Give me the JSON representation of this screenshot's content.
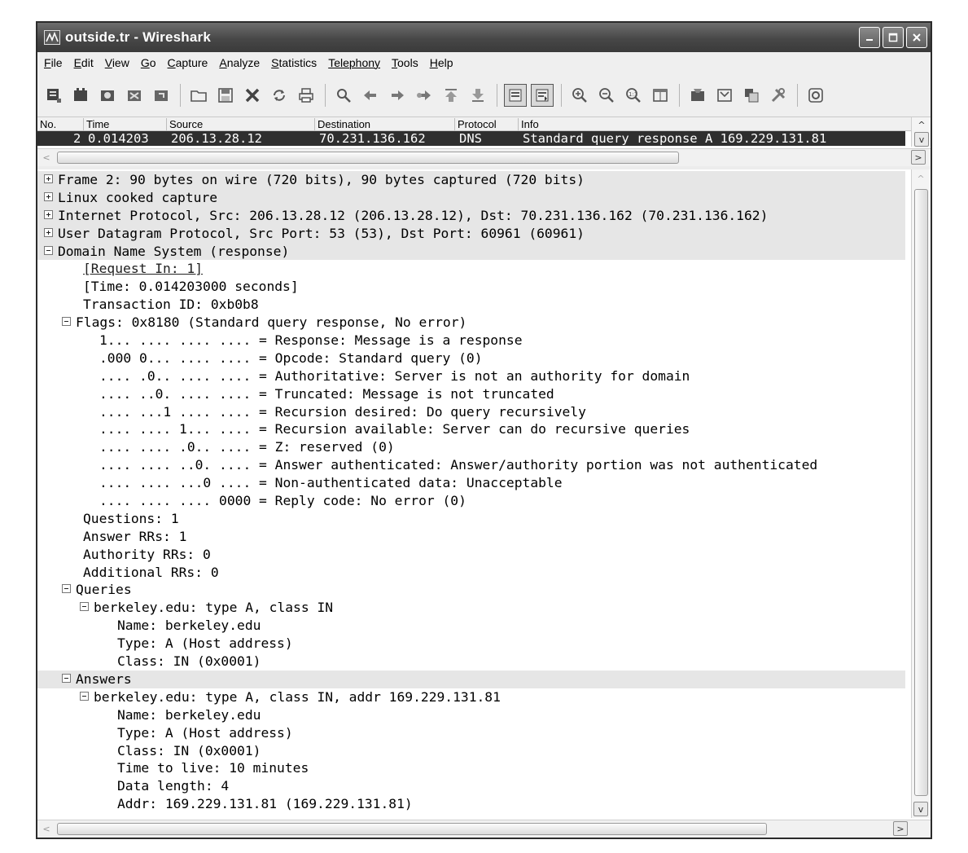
{
  "window": {
    "title": "outside.tr - Wireshark"
  },
  "menu": [
    {
      "acc": "F",
      "rest": "ile"
    },
    {
      "acc": "E",
      "rest": "dit"
    },
    {
      "acc": "V",
      "rest": "iew"
    },
    {
      "acc": "G",
      "rest": "o"
    },
    {
      "acc": "C",
      "rest": "apture"
    },
    {
      "acc": "A",
      "rest": "nalyze"
    },
    {
      "acc": "S",
      "rest": "tatistics"
    },
    {
      "acc": "",
      "rest": "Telephony"
    },
    {
      "acc": "T",
      "rest": "ools"
    },
    {
      "acc": "H",
      "rest": "elp"
    }
  ],
  "packet_list": {
    "columns": [
      "No.",
      "Time",
      "Source",
      "Destination",
      "Protocol",
      "Info"
    ],
    "row": {
      "no": "2",
      "time": "0.014203",
      "source": "206.13.28.12",
      "destination": "70.231.136.162",
      "protocol": "DNS",
      "info": "Standard query response A 169.229.131.81"
    }
  },
  "details": {
    "frame": "Frame 2: 90 bytes on wire (720 bits), 90 bytes captured (720 bits)",
    "linux": "Linux cooked capture",
    "ip": "Internet Protocol, Src: 206.13.28.12 (206.13.28.12), Dst: 70.231.136.162 (70.231.136.162)",
    "udp": "User Datagram Protocol, Src Port: 53 (53), Dst Port: 60961 (60961)",
    "dns": "Domain Name System (response)",
    "request_in": "[Request In: 1]",
    "time": "[Time: 0.014203000 seconds]",
    "txid": "Transaction ID: 0xb0b8",
    "flags": "Flags: 0x8180 (Standard query response, No error)",
    "flag_lines": [
      "1... .... .... .... = Response: Message is a response",
      ".000 0... .... .... = Opcode: Standard query (0)",
      ".... .0.. .... .... = Authoritative: Server is not an authority for domain",
      ".... ..0. .... .... = Truncated: Message is not truncated",
      ".... ...1 .... .... = Recursion desired: Do query recursively",
      ".... .... 1... .... = Recursion available: Server can do recursive queries",
      ".... .... .0.. .... = Z: reserved (0)",
      ".... .... ..0. .... = Answer authenticated: Answer/authority portion was not authenticated",
      ".... .... ...0 .... = Non-authenticated data: Unacceptable",
      ".... .... .... 0000 = Reply code: No error (0)"
    ],
    "questions": "Questions: 1",
    "answer_rrs": "Answer RRs: 1",
    "authority_rrs": "Authority RRs: 0",
    "additional_rrs": "Additional RRs: 0",
    "queries": "Queries",
    "query": "berkeley.edu: type A, class IN",
    "query_fields": [
      "Name: berkeley.edu",
      "Type: A (Host address)",
      "Class: IN (0x0001)"
    ],
    "answers": "Answers",
    "answer": "berkeley.edu: type A, class IN, addr 169.229.131.81",
    "answer_fields": [
      "Name: berkeley.edu",
      "Type: A (Host address)",
      "Class: IN (0x0001)",
      "Time to live: 10 minutes",
      "Data length: 4",
      "Addr: 169.229.131.81 (169.229.131.81)"
    ]
  }
}
